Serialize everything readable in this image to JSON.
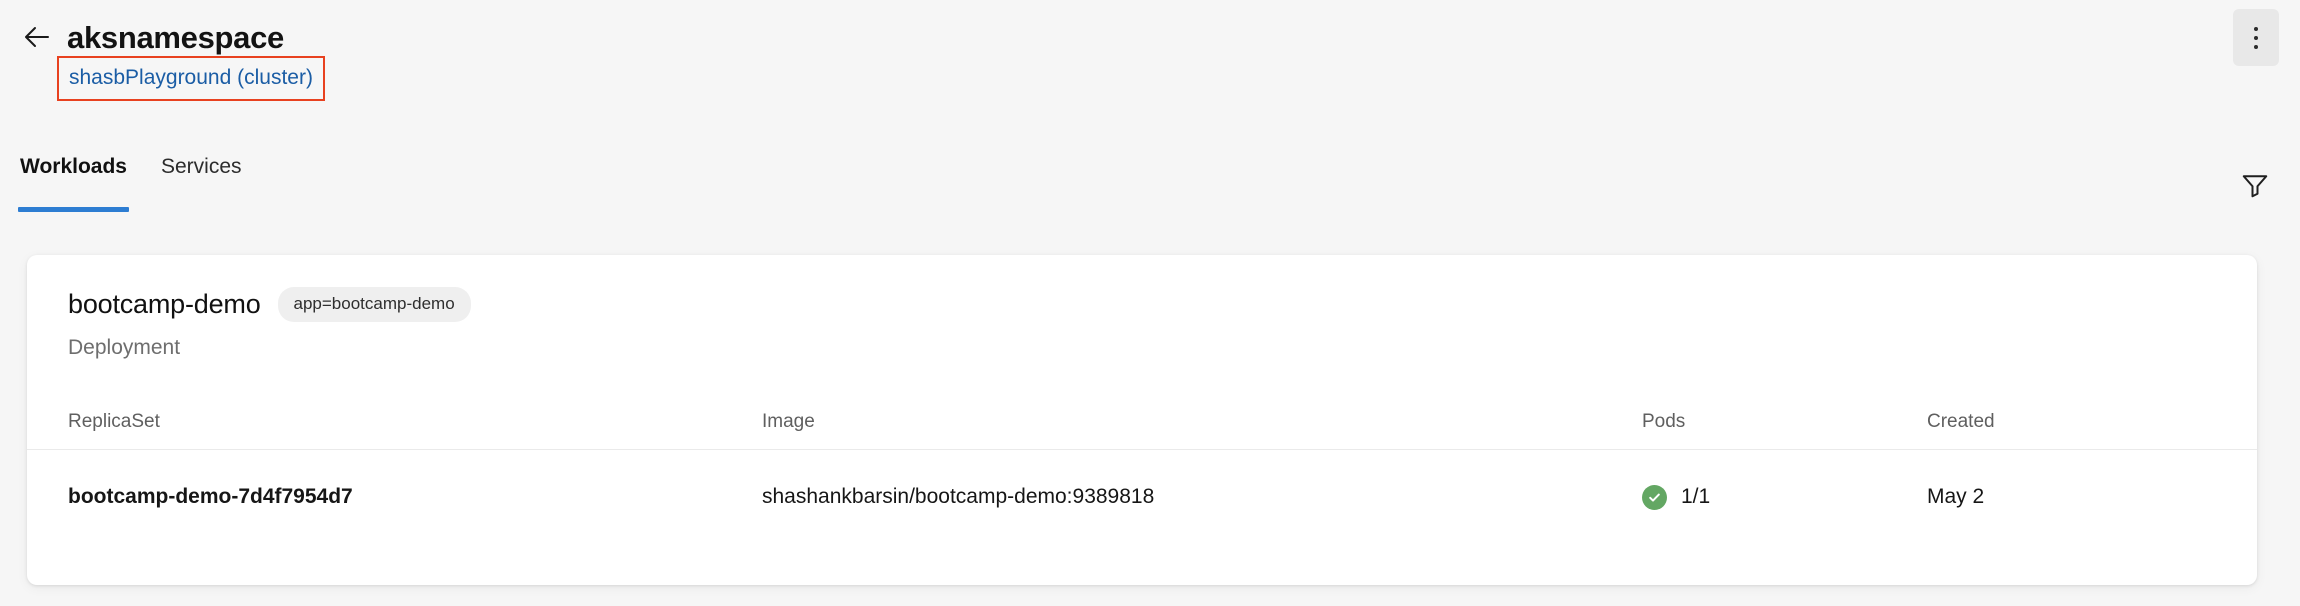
{
  "header": {
    "back_icon": "arrow-left-icon",
    "title": "aksnamespace",
    "cluster_link": "shasbPlayground (cluster)",
    "more_icon": "more-vertical-icon",
    "highlight_color": "#e8411f",
    "link_color": "#1b5da5"
  },
  "tabs": {
    "items": [
      {
        "label": "Workloads",
        "active": true
      },
      {
        "label": "Services",
        "active": false
      }
    ],
    "filter_icon": "filter-funnel-icon",
    "active_underline_color": "#2d7dd2"
  },
  "card": {
    "title": "bootcamp-demo",
    "badge": "app=bootcamp-demo",
    "subtitle": "Deployment",
    "table": {
      "columns": [
        "ReplicaSet",
        "Image",
        "Pods",
        "Created"
      ],
      "rows": [
        {
          "replicaset": "bootcamp-demo-7d4f7954d7",
          "image": "shashankbarsin/bootcamp-demo:9389818",
          "pods": "1/1",
          "pods_status_icon": "check-circle-icon",
          "pods_status_color": "#63a763",
          "created": "May 2"
        }
      ]
    }
  }
}
